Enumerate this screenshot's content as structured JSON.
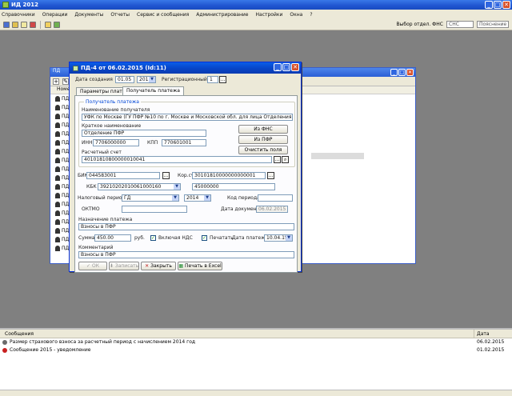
{
  "app": {
    "title": "ИД 2012",
    "minimize": "_",
    "maximize": "□",
    "close": "✕"
  },
  "menu": [
    "Справочники",
    "Операции",
    "Документы",
    "Отчеты",
    "Сервис и сообщения",
    "Администрирование",
    "Настройки",
    "Окна",
    "?"
  ],
  "toolbar": {
    "right_label": "Выбор отдел. ФНС",
    "combo1": "СНС",
    "combo2": "Пояснение"
  },
  "bg_window": {
    "title": "ПД",
    "list_header": "Номер",
    "rows": [
      "ПД",
      "ПД",
      "ПД",
      "ПД",
      "ПД",
      "ПД",
      "ПД",
      "ПД",
      "ПД",
      "ПД",
      "ПД",
      "ПД",
      "ПД",
      "ПД",
      "ПД",
      "ПД",
      "ПД",
      "ПД"
    ]
  },
  "dialog": {
    "title": "ПД-4 от 06.02.2015 (Id:11)",
    "date_label": "Дата создания",
    "date_value": "01.05",
    "date_year": "2015",
    "number_label": "Регистрационный №",
    "number_value": "1",
    "tabs": [
      "Параметры платежа",
      "Получатель платежа"
    ],
    "group_title": "Получатель платежа",
    "recipient_name_label": "Наименование получателя",
    "recipient_name_value": "УФК по Москве (ГУ ПФР №10 по г. Москве и Московской обл. для лица Отделения ПФР)",
    "short_name_label": "Краткое наименование",
    "short_name_value": "Отделение ПФР",
    "inn_label": "ИНН",
    "inn_value": "7706000000",
    "kpp_label": "КПП",
    "kpp_value": "770601001",
    "btn_from_fns": "Из ФНС",
    "btn_from_pfr": "Из ПФР",
    "btn_clear": "Очистить поля",
    "account_label": "Расчетный счет",
    "account_value": "40101810800000010041",
    "bik_label": "БИК",
    "bik_value": "044583001",
    "korr_label": "Кор.сч.",
    "korr_value": "30101810000000000001",
    "kbk_label": "КБК",
    "kbk_value": "39210202010061000160",
    "okato_label": "ОКАТО",
    "okato_value": "45000000",
    "period_label": "Налоговый период",
    "period_value": "ГД",
    "period_year": "2014",
    "period_code_label": "Код периода",
    "oktmo_label": "ОКТМО",
    "doc_date_label": "Дата документа",
    "doc_date_value": "06.02.2015",
    "purpose_label": "Назначение платежа",
    "purpose_value": "Взносы в ПФР",
    "sum_label": "Сумма",
    "sum_value": "450.00",
    "currency": "руб.",
    "cb_vat_label": "Включая НДС",
    "cb_vat_mark": "✓",
    "cb_print_label": "Печатать",
    "due_label": "Дата платежа",
    "due_value": "10.04.15",
    "comment_label": "Комментарий",
    "comment_value": "Взносы в ПФР",
    "btn_ok": "ОК",
    "btn_save": "Записать",
    "btn_close": "Закрыть",
    "btn_print": "Печать в Excel"
  },
  "bottom": {
    "col_text": "Сообщения",
    "col_date": "Дата",
    "rows": [
      {
        "text": "Размер страхового взноса за расчетный период с начислением 2014 год",
        "date": "06.02.2015",
        "color": "#6a6a6a"
      },
      {
        "text": "Сообщение 2015 - уведомление",
        "date": "01.02.2015",
        "color": "#c82020"
      }
    ]
  }
}
